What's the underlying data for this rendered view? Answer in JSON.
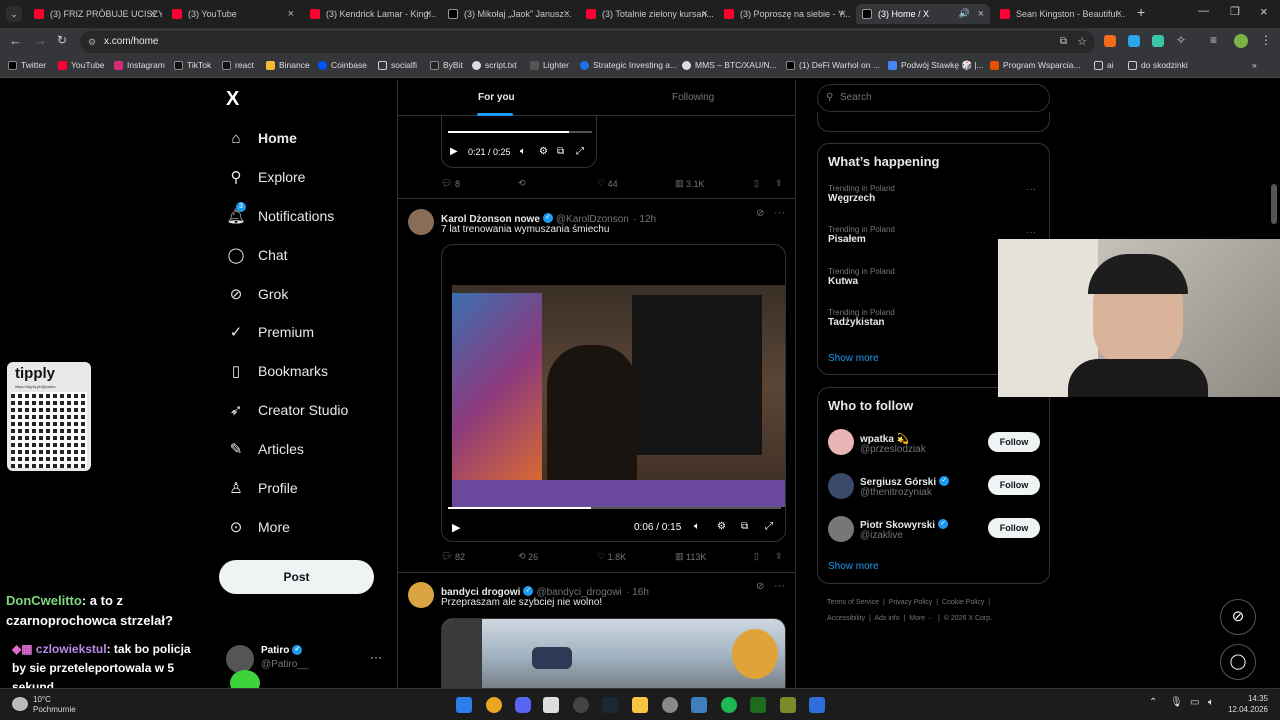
{
  "browser": {
    "tabs": [
      {
        "title": "(3) FRIZ PRÓBUJE UCISZY..."
      },
      {
        "title": "(3) YouTube"
      },
      {
        "title": "(3) Kendrick Lamar - King..."
      },
      {
        "title": "(3) Mikołaj „Jaok” Janusz..."
      },
      {
        "title": "(3) Totalnie zielony kursan..."
      },
      {
        "title": "(3) Poproszę na siebie - Y..."
      },
      {
        "title": "(3) Home / X"
      },
      {
        "title": "Sean Kingston - Beautiful..."
      }
    ],
    "url": "x.com/home",
    "bookmarks": [
      "Twitter",
      "YouTube",
      "Instagram",
      "TikTok",
      "react",
      "Binance",
      "Coinbase",
      "socialfi",
      "ByBit",
      "script.txt",
      "Lighter",
      "Strategic Investing a...",
      "MMS – BTC/XAU/N...",
      "(1) DeFi Warhol on ...",
      "Podwój Stawkę 🎲 |...",
      "Program Wsparcia...",
      "ai",
      "do skodzinki"
    ]
  },
  "sidebar": {
    "logo": "X",
    "items": [
      {
        "label": "Home",
        "icon": "home-icon"
      },
      {
        "label": "Explore",
        "icon": "search-icon"
      },
      {
        "label": "Notifications",
        "icon": "bell-icon",
        "badge": "3"
      },
      {
        "label": "Chat",
        "icon": "chat-icon"
      },
      {
        "label": "Grok",
        "icon": "grok-icon"
      },
      {
        "label": "Premium",
        "icon": "premium-icon"
      },
      {
        "label": "Bookmarks",
        "icon": "bookmark-icon"
      },
      {
        "label": "Creator Studio",
        "icon": "rocket-icon"
      },
      {
        "label": "Articles",
        "icon": "articles-icon"
      },
      {
        "label": "Profile",
        "icon": "profile-icon"
      },
      {
        "label": "More",
        "icon": "more-icon"
      }
    ],
    "post_label": "Post",
    "account": {
      "name": "Patiro",
      "handle": "@Patiro__"
    }
  },
  "feed": {
    "tabs": [
      "For you",
      "Following"
    ],
    "top_video": {
      "time": "0:21 / 0:25"
    },
    "top_actions": {
      "replies": "8",
      "likes": "44",
      "views": "3.1K"
    },
    "tweets": [
      {
        "name": "Karol Dżonson nowe",
        "handle": "@KarolDzonson",
        "time": "· 12h",
        "text": "7 lat trenowania wymuszania śmiechu",
        "video_time": "0:06 / 0:15",
        "progress": 0.43,
        "replies": "82",
        "reposts": "26",
        "likes": "1.8K",
        "views": "113K"
      },
      {
        "name": "bandyci drogowi",
        "handle": "@bandyci_drogowi",
        "time": "· 16h",
        "text": "Przepraszam ale szybciej nie wolno!"
      }
    ]
  },
  "right": {
    "search_placeholder": "Search",
    "whats_happening": "What’s happening",
    "trends": [
      {
        "context": "Trending in Poland",
        "name": "Węgrzech"
      },
      {
        "context": "Trending in Poland",
        "name": "Pisałem"
      },
      {
        "context": "Trending in Poland",
        "name": "Kutwa"
      },
      {
        "context": "Trending in Poland",
        "name": "Tadżykistan"
      }
    ],
    "show_more": "Show more",
    "who_to_follow": "Who to follow",
    "follow_label": "Follow",
    "suggestions": [
      {
        "name": "wpatka 💫",
        "handle": "@przeslodziak"
      },
      {
        "name": "Sergiusz Górski",
        "handle": "@thenitrozyniak"
      },
      {
        "name": "Piotr Skowyrski",
        "handle": "@izaklive"
      }
    ],
    "footer1": [
      "Terms of Service",
      "Privacy Policy",
      "Cookie Policy"
    ],
    "footer2": [
      "Accessibility",
      "Ads info",
      "More ···",
      "© 2026 X Corp."
    ]
  },
  "overlay": {
    "tipply": "tipply",
    "tipply_url": "https://tipply.pl/@patiro",
    "chat": [
      {
        "user": "DonCwelitto",
        "msg": ": a to z czarnoprochowca strzelał?"
      },
      {
        "user": "czlowiekstul",
        "msg": ": tak bo policja by sie przeteleportowala w 5 sekund"
      }
    ]
  },
  "taskbar": {
    "weather_temp": "10°C",
    "weather_desc": "Pochmurnie",
    "time": "14:35",
    "date": "12.04.2026"
  },
  "colors": {
    "accent": "#1d9bf0",
    "bg": "#000000",
    "border": "#2f3336",
    "muted": "#71767b"
  }
}
